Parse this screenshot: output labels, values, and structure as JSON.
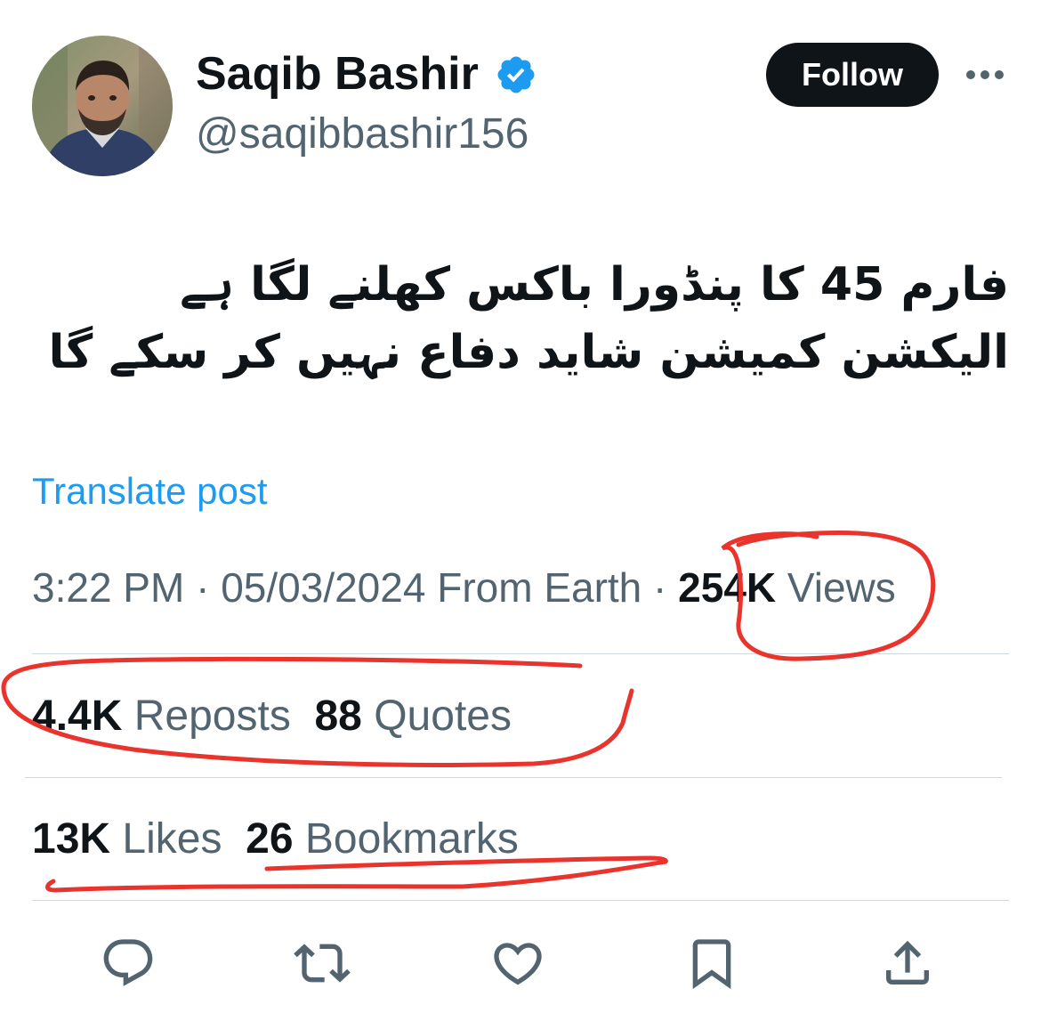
{
  "author": {
    "display_name": "Saqib Bashir",
    "handle": "@saqibbashir156",
    "verified": true,
    "avatar_icon": "profile-photo"
  },
  "header": {
    "follow_label": "Follow",
    "more_icon": "more-horizontal-icon"
  },
  "post": {
    "text": "فارم 45 کا پنڈورا باکس کھلنے لگا ہے الیکشن کمیشن شاید دفاع نہیں کر سکے گا",
    "translate_label": "Translate post"
  },
  "meta": {
    "time": "3:22 PM",
    "separator1": " · ",
    "date": "05/03/2024",
    "source": " From Earth",
    "separator2": " · ",
    "views_count": "254K",
    "views_label": " Views"
  },
  "stats": {
    "reposts_count": "4.4K",
    "reposts_label": " Reposts",
    "quotes_count": "88",
    "quotes_label": " Quotes",
    "likes_count": "13K",
    "likes_label": " Likes",
    "bookmarks_count": "26",
    "bookmarks_label": " Bookmarks"
  },
  "actions": [
    {
      "name": "reply",
      "icon": "reply-icon"
    },
    {
      "name": "repost",
      "icon": "repost-icon"
    },
    {
      "name": "like",
      "icon": "heart-icon"
    },
    {
      "name": "bookmark",
      "icon": "bookmark-icon"
    },
    {
      "name": "share",
      "icon": "share-icon"
    }
  ],
  "colors": {
    "text_primary": "#0f1419",
    "text_secondary": "#536471",
    "link": "#1d9bf0",
    "verified": "#1d9bf0",
    "annotation": "#e8342c",
    "divider": "#cfd9de"
  }
}
